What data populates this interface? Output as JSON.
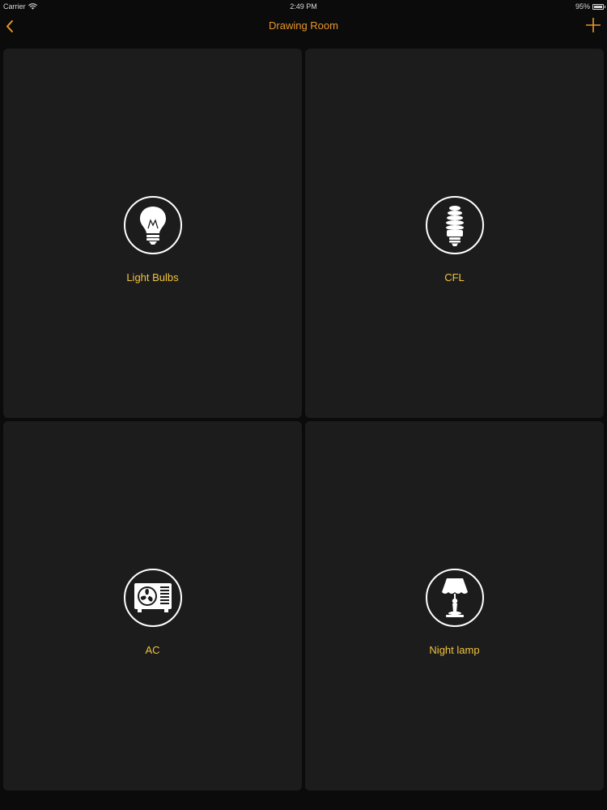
{
  "status_bar": {
    "carrier": "Carrier",
    "time": "2:49 PM",
    "battery": "95%",
    "battery_level": 0.95,
    "wifi_icon": "wifi-icon"
  },
  "nav": {
    "title": "Drawing Room",
    "back_icon": "chevron-left-icon",
    "add_icon": "plus-icon",
    "accent_color": "#e9962a"
  },
  "devices": [
    {
      "label": "Light Bulbs",
      "icon": "light-bulb-icon"
    },
    {
      "label": "CFL",
      "icon": "cfl-bulb-icon"
    },
    {
      "label": "AC",
      "icon": "air-conditioner-icon"
    },
    {
      "label": "Night lamp",
      "icon": "night-lamp-icon"
    }
  ],
  "colors": {
    "tile_background": "#1c1c1d",
    "label_color": "#f2c33c",
    "page_background": "#0b0b0b"
  }
}
